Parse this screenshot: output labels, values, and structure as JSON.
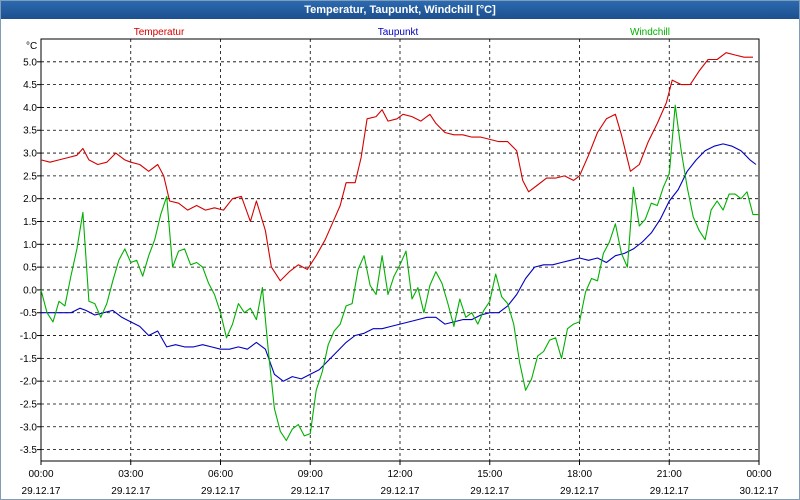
{
  "window": {
    "title": "Temperatur, Taupunkt, Windchill [°C]"
  },
  "chart_data": {
    "type": "line",
    "title": "Temperatur, Taupunkt, Windchill [°C]",
    "ylabel": "°C",
    "ylim": [
      -3.75,
      5.5
    ],
    "yticks": [
      -3.5,
      -3.0,
      -2.5,
      -2.0,
      -1.5,
      -1.0,
      -0.5,
      0.0,
      0.5,
      1.0,
      1.5,
      2.0,
      2.5,
      3.0,
      3.5,
      4.0,
      4.5,
      5.0
    ],
    "ytick_labels": [
      "-3.5",
      "-3.0",
      "-2.5",
      "-2.0",
      "-1.5",
      "-1.0",
      "-0.5",
      "0.0",
      "0.5",
      "1.0",
      "1.5",
      "2.0",
      "2.5",
      "3.0",
      "3.5",
      "4.0",
      "4.5",
      "5.0"
    ],
    "xlim": [
      0,
      24
    ],
    "xticks": [
      0,
      3,
      6,
      9,
      12,
      15,
      18,
      21,
      24
    ],
    "xtick_time_labels": [
      "00:00",
      "03:00",
      "06:00",
      "09:00",
      "12:00",
      "15:00",
      "18:00",
      "21:00",
      "00:00"
    ],
    "xtick_date_labels": [
      "29.12.17",
      "29.12.17",
      "29.12.17",
      "29.12.17",
      "29.12.17",
      "29.12.17",
      "29.12.17",
      "29.12.17",
      "30.12.17"
    ],
    "grid": true,
    "legend_position": "top",
    "series": [
      {
        "name": "Temperatur",
        "color": "#d40000",
        "points": [
          [
            0.0,
            2.85
          ],
          [
            0.3,
            2.8
          ],
          [
            0.6,
            2.85
          ],
          [
            0.9,
            2.9
          ],
          [
            1.2,
            2.95
          ],
          [
            1.4,
            3.1
          ],
          [
            1.6,
            2.85
          ],
          [
            1.9,
            2.75
          ],
          [
            2.2,
            2.8
          ],
          [
            2.5,
            3.0
          ],
          [
            2.8,
            2.85
          ],
          [
            3.0,
            2.8
          ],
          [
            3.3,
            2.75
          ],
          [
            3.6,
            2.6
          ],
          [
            3.9,
            2.75
          ],
          [
            4.1,
            2.5
          ],
          [
            4.3,
            1.95
          ],
          [
            4.6,
            1.9
          ],
          [
            4.9,
            1.75
          ],
          [
            5.2,
            1.85
          ],
          [
            5.5,
            1.75
          ],
          [
            5.8,
            1.8
          ],
          [
            6.1,
            1.75
          ],
          [
            6.4,
            2.0
          ],
          [
            6.7,
            2.05
          ],
          [
            7.0,
            1.5
          ],
          [
            7.2,
            1.95
          ],
          [
            7.5,
            1.3
          ],
          [
            7.7,
            0.5
          ],
          [
            8.0,
            0.2
          ],
          [
            8.3,
            0.4
          ],
          [
            8.6,
            0.55
          ],
          [
            8.9,
            0.45
          ],
          [
            9.2,
            0.75
          ],
          [
            9.5,
            1.1
          ],
          [
            9.8,
            1.55
          ],
          [
            10.0,
            1.85
          ],
          [
            10.2,
            2.35
          ],
          [
            10.5,
            2.35
          ],
          [
            10.7,
            2.9
          ],
          [
            10.9,
            3.75
          ],
          [
            11.2,
            3.8
          ],
          [
            11.4,
            3.95
          ],
          [
            11.6,
            3.7
          ],
          [
            11.9,
            3.75
          ],
          [
            12.1,
            3.85
          ],
          [
            12.4,
            3.8
          ],
          [
            12.7,
            3.7
          ],
          [
            13.0,
            3.85
          ],
          [
            13.2,
            3.65
          ],
          [
            13.5,
            3.45
          ],
          [
            13.8,
            3.4
          ],
          [
            14.1,
            3.4
          ],
          [
            14.4,
            3.35
          ],
          [
            14.7,
            3.35
          ],
          [
            15.0,
            3.3
          ],
          [
            15.3,
            3.25
          ],
          [
            15.6,
            3.25
          ],
          [
            15.9,
            3.05
          ],
          [
            16.1,
            2.4
          ],
          [
            16.3,
            2.15
          ],
          [
            16.6,
            2.3
          ],
          [
            16.9,
            2.45
          ],
          [
            17.2,
            2.45
          ],
          [
            17.5,
            2.5
          ],
          [
            17.8,
            2.4
          ],
          [
            18.0,
            2.5
          ],
          [
            18.3,
            2.95
          ],
          [
            18.6,
            3.45
          ],
          [
            18.9,
            3.75
          ],
          [
            19.2,
            3.85
          ],
          [
            19.4,
            3.4
          ],
          [
            19.7,
            2.6
          ],
          [
            20.0,
            2.75
          ],
          [
            20.3,
            3.25
          ],
          [
            20.6,
            3.65
          ],
          [
            20.9,
            4.1
          ],
          [
            21.1,
            4.6
          ],
          [
            21.4,
            4.5
          ],
          [
            21.7,
            4.5
          ],
          [
            22.0,
            4.8
          ],
          [
            22.3,
            5.05
          ],
          [
            22.6,
            5.05
          ],
          [
            22.9,
            5.2
          ],
          [
            23.2,
            5.15
          ],
          [
            23.5,
            5.1
          ],
          [
            23.8,
            5.1
          ]
        ]
      },
      {
        "name": "Taupunkt",
        "color": "#0000c0",
        "points": [
          [
            0.0,
            -0.5
          ],
          [
            0.5,
            -0.5
          ],
          [
            1.0,
            -0.5
          ],
          [
            1.3,
            -0.4
          ],
          [
            1.5,
            -0.45
          ],
          [
            1.8,
            -0.55
          ],
          [
            2.1,
            -0.5
          ],
          [
            2.4,
            -0.45
          ],
          [
            2.7,
            -0.6
          ],
          [
            3.0,
            -0.7
          ],
          [
            3.3,
            -0.8
          ],
          [
            3.6,
            -1.0
          ],
          [
            3.9,
            -0.9
          ],
          [
            4.2,
            -1.25
          ],
          [
            4.5,
            -1.2
          ],
          [
            4.8,
            -1.25
          ],
          [
            5.1,
            -1.25
          ],
          [
            5.4,
            -1.2
          ],
          [
            5.7,
            -1.25
          ],
          [
            6.0,
            -1.3
          ],
          [
            6.3,
            -1.3
          ],
          [
            6.6,
            -1.25
          ],
          [
            6.9,
            -1.3
          ],
          [
            7.2,
            -1.15
          ],
          [
            7.5,
            -1.3
          ],
          [
            7.8,
            -1.85
          ],
          [
            8.1,
            -2.0
          ],
          [
            8.4,
            -1.9
          ],
          [
            8.7,
            -1.95
          ],
          [
            9.0,
            -1.85
          ],
          [
            9.3,
            -1.75
          ],
          [
            9.6,
            -1.55
          ],
          [
            9.9,
            -1.35
          ],
          [
            10.2,
            -1.15
          ],
          [
            10.5,
            -1.0
          ],
          [
            10.8,
            -0.95
          ],
          [
            11.1,
            -0.85
          ],
          [
            11.4,
            -0.85
          ],
          [
            11.7,
            -0.8
          ],
          [
            12.0,
            -0.75
          ],
          [
            12.3,
            -0.7
          ],
          [
            12.6,
            -0.65
          ],
          [
            12.9,
            -0.6
          ],
          [
            13.2,
            -0.6
          ],
          [
            13.5,
            -0.75
          ],
          [
            13.8,
            -0.7
          ],
          [
            14.1,
            -0.65
          ],
          [
            14.4,
            -0.65
          ],
          [
            14.7,
            -0.55
          ],
          [
            15.0,
            -0.5
          ],
          [
            15.3,
            -0.5
          ],
          [
            15.6,
            -0.35
          ],
          [
            15.9,
            -0.1
          ],
          [
            16.2,
            0.25
          ],
          [
            16.5,
            0.5
          ],
          [
            16.8,
            0.55
          ],
          [
            17.1,
            0.55
          ],
          [
            17.4,
            0.6
          ],
          [
            17.7,
            0.65
          ],
          [
            18.0,
            0.7
          ],
          [
            18.3,
            0.65
          ],
          [
            18.6,
            0.7
          ],
          [
            18.9,
            0.6
          ],
          [
            19.2,
            0.75
          ],
          [
            19.5,
            0.8
          ],
          [
            19.8,
            0.9
          ],
          [
            20.1,
            1.05
          ],
          [
            20.4,
            1.25
          ],
          [
            20.7,
            1.55
          ],
          [
            21.0,
            1.95
          ],
          [
            21.3,
            2.2
          ],
          [
            21.6,
            2.6
          ],
          [
            21.9,
            2.85
          ],
          [
            22.2,
            3.05
          ],
          [
            22.5,
            3.15
          ],
          [
            22.8,
            3.2
          ],
          [
            23.1,
            3.15
          ],
          [
            23.4,
            3.05
          ],
          [
            23.7,
            2.85
          ],
          [
            23.9,
            2.75
          ]
        ]
      },
      {
        "name": "Windchill",
        "color": "#00b000",
        "points": [
          [
            0.0,
            0.0
          ],
          [
            0.2,
            -0.5
          ],
          [
            0.4,
            -0.7
          ],
          [
            0.6,
            -0.25
          ],
          [
            0.8,
            -0.35
          ],
          [
            1.0,
            0.3
          ],
          [
            1.2,
            0.9
          ],
          [
            1.4,
            1.7
          ],
          [
            1.6,
            -0.25
          ],
          [
            1.8,
            -0.3
          ],
          [
            2.0,
            -0.6
          ],
          [
            2.2,
            -0.3
          ],
          [
            2.4,
            0.2
          ],
          [
            2.6,
            0.65
          ],
          [
            2.8,
            0.9
          ],
          [
            3.0,
            0.6
          ],
          [
            3.2,
            0.65
          ],
          [
            3.4,
            0.3
          ],
          [
            3.6,
            0.75
          ],
          [
            3.8,
            1.1
          ],
          [
            4.0,
            1.65
          ],
          [
            4.2,
            2.05
          ],
          [
            4.4,
            0.5
          ],
          [
            4.6,
            0.85
          ],
          [
            4.8,
            0.9
          ],
          [
            5.0,
            0.55
          ],
          [
            5.2,
            0.6
          ],
          [
            5.4,
            0.5
          ],
          [
            5.6,
            0.15
          ],
          [
            5.8,
            -0.1
          ],
          [
            6.0,
            -0.5
          ],
          [
            6.2,
            -1.05
          ],
          [
            6.4,
            -0.75
          ],
          [
            6.6,
            -0.3
          ],
          [
            6.8,
            -0.5
          ],
          [
            7.0,
            -0.4
          ],
          [
            7.2,
            -0.65
          ],
          [
            7.4,
            0.05
          ],
          [
            7.6,
            -1.35
          ],
          [
            7.8,
            -2.6
          ],
          [
            8.0,
            -3.1
          ],
          [
            8.2,
            -3.3
          ],
          [
            8.4,
            -3.05
          ],
          [
            8.6,
            -2.95
          ],
          [
            8.8,
            -3.2
          ],
          [
            9.0,
            -3.15
          ],
          [
            9.2,
            -2.2
          ],
          [
            9.4,
            -1.8
          ],
          [
            9.6,
            -1.2
          ],
          [
            9.8,
            -0.9
          ],
          [
            10.0,
            -0.75
          ],
          [
            10.2,
            -0.35
          ],
          [
            10.4,
            -0.3
          ],
          [
            10.6,
            0.45
          ],
          [
            10.8,
            0.75
          ],
          [
            11.0,
            0.1
          ],
          [
            11.2,
            -0.1
          ],
          [
            11.4,
            0.75
          ],
          [
            11.6,
            -0.1
          ],
          [
            11.8,
            0.3
          ],
          [
            12.0,
            0.55
          ],
          [
            12.2,
            0.85
          ],
          [
            12.4,
            -0.2
          ],
          [
            12.6,
            0.05
          ],
          [
            12.8,
            -0.5
          ],
          [
            13.0,
            0.1
          ],
          [
            13.2,
            0.4
          ],
          [
            13.4,
            0.15
          ],
          [
            13.6,
            -0.3
          ],
          [
            13.8,
            -0.8
          ],
          [
            14.0,
            -0.2
          ],
          [
            14.2,
            -0.6
          ],
          [
            14.4,
            -0.5
          ],
          [
            14.6,
            -0.75
          ],
          [
            14.8,
            -0.45
          ],
          [
            15.0,
            -0.25
          ],
          [
            15.2,
            0.35
          ],
          [
            15.4,
            -0.15
          ],
          [
            15.6,
            -0.3
          ],
          [
            15.8,
            -0.75
          ],
          [
            16.0,
            -1.6
          ],
          [
            16.2,
            -2.2
          ],
          [
            16.4,
            -1.95
          ],
          [
            16.6,
            -1.45
          ],
          [
            16.8,
            -1.35
          ],
          [
            17.0,
            -1.1
          ],
          [
            17.2,
            -1.05
          ],
          [
            17.4,
            -1.5
          ],
          [
            17.6,
            -0.85
          ],
          [
            17.8,
            -0.75
          ],
          [
            18.0,
            -0.7
          ],
          [
            18.2,
            -0.05
          ],
          [
            18.4,
            0.25
          ],
          [
            18.6,
            0.2
          ],
          [
            18.8,
            0.8
          ],
          [
            19.0,
            1.05
          ],
          [
            19.2,
            1.45
          ],
          [
            19.4,
            0.8
          ],
          [
            19.6,
            0.5
          ],
          [
            19.8,
            2.25
          ],
          [
            20.0,
            1.4
          ],
          [
            20.2,
            1.55
          ],
          [
            20.4,
            1.9
          ],
          [
            20.6,
            1.85
          ],
          [
            20.8,
            2.25
          ],
          [
            21.0,
            2.55
          ],
          [
            21.2,
            4.05
          ],
          [
            21.4,
            3.05
          ],
          [
            21.6,
            2.25
          ],
          [
            21.8,
            1.6
          ],
          [
            22.0,
            1.3
          ],
          [
            22.2,
            1.1
          ],
          [
            22.4,
            1.75
          ],
          [
            22.6,
            1.95
          ],
          [
            22.8,
            1.75
          ],
          [
            23.0,
            2.1
          ],
          [
            23.2,
            2.1
          ],
          [
            23.4,
            2.0
          ],
          [
            23.6,
            2.15
          ],
          [
            23.8,
            1.65
          ],
          [
            24.0,
            1.65
          ]
        ]
      }
    ]
  }
}
